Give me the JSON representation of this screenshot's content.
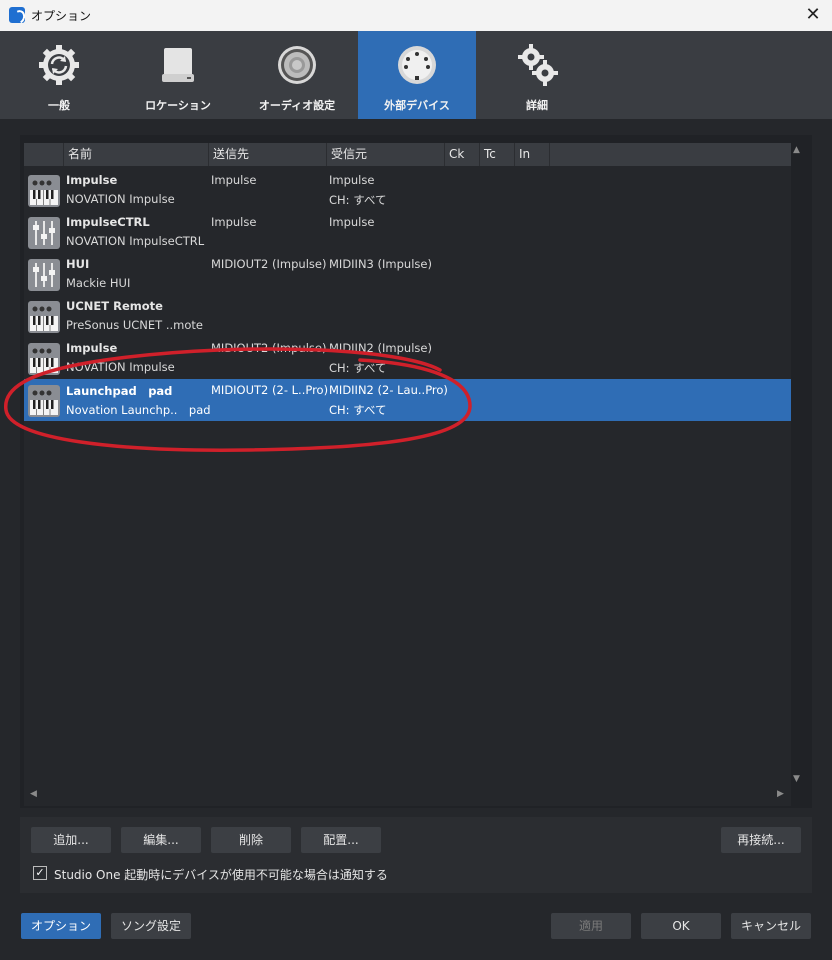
{
  "window": {
    "title": "オプション",
    "close": "✕"
  },
  "tabs": [
    {
      "label": "一般",
      "icon": "sync-gear-icon",
      "active": false
    },
    {
      "label": "ロケーション",
      "icon": "drive-icon",
      "active": false
    },
    {
      "label": "オーディオ設定",
      "icon": "speaker-icon",
      "active": false
    },
    {
      "label": "外部デバイス",
      "icon": "midi-connector-icon",
      "active": true
    },
    {
      "label": "詳細",
      "icon": "gears-icon",
      "active": false
    }
  ],
  "table": {
    "columns": [
      "名前",
      "送信先",
      "受信元",
      "Ck",
      "Tc",
      "In"
    ],
    "rows": [
      {
        "icon": "keyboard-icon",
        "name": "Impulse",
        "model": "NOVATION Impulse",
        "send": "Impulse",
        "recv": "Impulse",
        "ch": "CH: すべて",
        "selected": false
      },
      {
        "icon": "mixer-icon",
        "name": "ImpulseCTRL",
        "model": "NOVATION ImpulseCTRL",
        "send": "Impulse",
        "recv": "Impulse",
        "ch": "",
        "selected": false
      },
      {
        "icon": "mixer-icon",
        "name": "HUI",
        "model": "Mackie HUI",
        "send": "MIDIOUT2 (Impulse)",
        "recv": "MIDIIN3 (Impulse)",
        "ch": "",
        "selected": false
      },
      {
        "icon": "keyboard-icon",
        "name": "UCNET Remote",
        "model": "PreSonus UCNET ..mote",
        "send": "",
        "recv": "",
        "ch": "",
        "selected": false
      },
      {
        "icon": "keyboard-icon",
        "name": "Impulse",
        "model": "NOVATION Impulse",
        "send": "MIDIOUT2 (Impulse)",
        "recv": "MIDIIN2 (Impulse)",
        "ch": "CH: すべて",
        "selected": false
      },
      {
        "icon": "keyboard-icon",
        "name": "Launchpad　pad",
        "model": "Novation Launchp..　pad",
        "send": "MIDIOUT2 (2- L..Pro)",
        "recv": "MIDIIN2 (2- Lau..Pro)",
        "ch": "CH: すべて",
        "selected": true
      }
    ]
  },
  "scroll": {
    "up": "▲",
    "down": "▼",
    "left": "◀",
    "right": "▶"
  },
  "buttons": {
    "add": "追加...",
    "edit": "編集...",
    "remove": "削除",
    "placement": "配置...",
    "reconnect": "再接続...",
    "options": "オプション",
    "song_settings": "ソング設定",
    "apply": "適用",
    "ok": "OK",
    "cancel": "キャンセル"
  },
  "notify": {
    "checked": true,
    "mark": "✓",
    "label": "Studio One 起動時にデバイスが使用不可能な場合は通知する"
  },
  "colors": {
    "accent": "#2f6db5",
    "annotation": "#d0202a",
    "background": "#25272b"
  }
}
